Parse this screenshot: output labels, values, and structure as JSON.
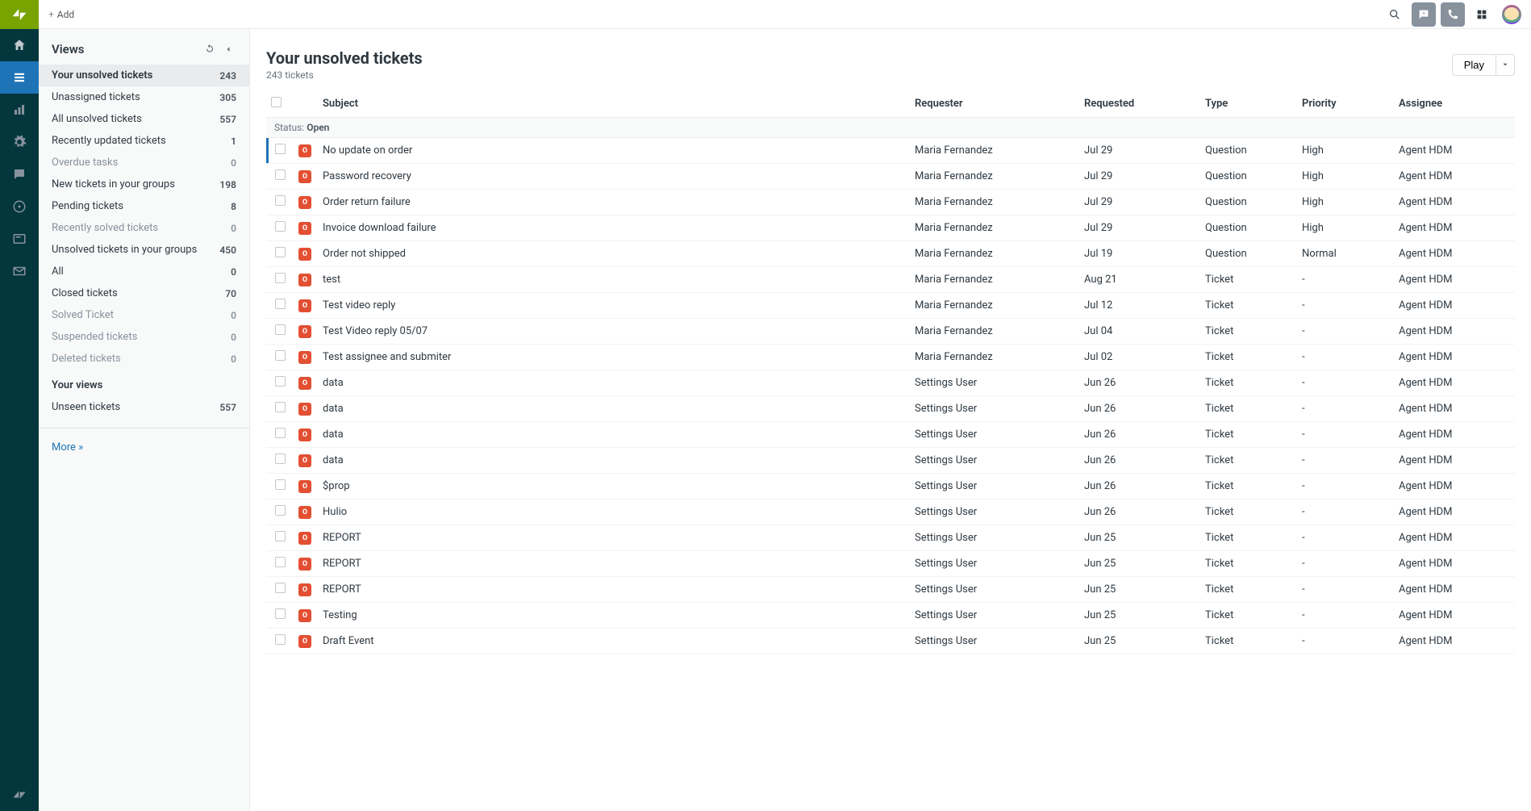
{
  "topbar": {
    "add_label": "Add"
  },
  "rail": {
    "items": [
      "home",
      "views",
      "reporting",
      "admin",
      "chat",
      "recent",
      "ssh",
      "mail"
    ]
  },
  "views_panel": {
    "title": "Views",
    "views": [
      {
        "label": "Your unsolved tickets",
        "count": "243",
        "selected": true,
        "muted": false
      },
      {
        "label": "Unassigned tickets",
        "count": "305",
        "selected": false,
        "muted": false
      },
      {
        "label": "All unsolved tickets",
        "count": "557",
        "selected": false,
        "muted": false
      },
      {
        "label": "Recently updated tickets",
        "count": "1",
        "selected": false,
        "muted": false
      },
      {
        "label": "Overdue tasks",
        "count": "0",
        "selected": false,
        "muted": true
      },
      {
        "label": "New tickets in your groups",
        "count": "198",
        "selected": false,
        "muted": false
      },
      {
        "label": "Pending tickets",
        "count": "8",
        "selected": false,
        "muted": false
      },
      {
        "label": "Recently solved tickets",
        "count": "0",
        "selected": false,
        "muted": true
      },
      {
        "label": "Unsolved tickets in your groups",
        "count": "450",
        "selected": false,
        "muted": false
      },
      {
        "label": "All",
        "count": "0",
        "selected": false,
        "muted": false
      },
      {
        "label": "Closed tickets",
        "count": "70",
        "selected": false,
        "muted": false
      },
      {
        "label": "Solved Ticket",
        "count": "0",
        "selected": false,
        "muted": true
      },
      {
        "label": "Suspended tickets",
        "count": "0",
        "selected": false,
        "muted": true
      },
      {
        "label": "Deleted tickets",
        "count": "0",
        "selected": false,
        "muted": true
      }
    ],
    "your_views_title": "Your views",
    "your_views": [
      {
        "label": "Unseen tickets",
        "count": "557",
        "selected": false,
        "muted": false
      }
    ],
    "more_label": "More »"
  },
  "tickets": {
    "title": "Your unsolved tickets",
    "subtitle": "243 tickets",
    "play_label": "Play",
    "columns": {
      "subject": "Subject",
      "requester": "Requester",
      "requested": "Requested",
      "type": "Type",
      "priority": "Priority",
      "assignee": "Assignee"
    },
    "status_group_label": "Status:",
    "status_group_value": "Open",
    "status_badge_text": "O",
    "rows": [
      {
        "subject": "No update on order",
        "requester": "Maria Fernandez",
        "requested": "Jul 29",
        "type": "Question",
        "priority": "High",
        "assignee": "Agent HDM",
        "hl": true
      },
      {
        "subject": "Password recovery",
        "requester": "Maria Fernandez",
        "requested": "Jul 29",
        "type": "Question",
        "priority": "High",
        "assignee": "Agent HDM"
      },
      {
        "subject": "Order return failure",
        "requester": "Maria Fernandez",
        "requested": "Jul 29",
        "type": "Question",
        "priority": "High",
        "assignee": "Agent HDM"
      },
      {
        "subject": "Invoice download failure",
        "requester": "Maria Fernandez",
        "requested": "Jul 29",
        "type": "Question",
        "priority": "High",
        "assignee": "Agent HDM"
      },
      {
        "subject": "Order not shipped",
        "requester": "Maria Fernandez",
        "requested": "Jul 19",
        "type": "Question",
        "priority": "Normal",
        "assignee": "Agent HDM"
      },
      {
        "subject": "test",
        "requester": "Maria Fernandez",
        "requested": "Aug 21",
        "type": "Ticket",
        "priority": "-",
        "assignee": "Agent HDM"
      },
      {
        "subject": "Test video reply",
        "requester": "Maria Fernandez",
        "requested": "Jul 12",
        "type": "Ticket",
        "priority": "-",
        "assignee": "Agent HDM"
      },
      {
        "subject": "Test Video reply 05/07",
        "requester": "Maria Fernandez",
        "requested": "Jul 04",
        "type": "Ticket",
        "priority": "-",
        "assignee": "Agent HDM"
      },
      {
        "subject": "Test assignee and submiter",
        "requester": "Maria Fernandez",
        "requested": "Jul 02",
        "type": "Ticket",
        "priority": "-",
        "assignee": "Agent HDM"
      },
      {
        "subject": "data",
        "requester": "Settings User",
        "requested": "Jun 26",
        "type": "Ticket",
        "priority": "-",
        "assignee": "Agent HDM"
      },
      {
        "subject": "data",
        "requester": "Settings User",
        "requested": "Jun 26",
        "type": "Ticket",
        "priority": "-",
        "assignee": "Agent HDM"
      },
      {
        "subject": "data",
        "requester": "Settings User",
        "requested": "Jun 26",
        "type": "Ticket",
        "priority": "-",
        "assignee": "Agent HDM"
      },
      {
        "subject": "data",
        "requester": "Settings User",
        "requested": "Jun 26",
        "type": "Ticket",
        "priority": "-",
        "assignee": "Agent HDM"
      },
      {
        "subject": "$prop",
        "requester": "Settings User",
        "requested": "Jun 26",
        "type": "Ticket",
        "priority": "-",
        "assignee": "Agent HDM"
      },
      {
        "subject": "Hulio",
        "requester": "Settings User",
        "requested": "Jun 26",
        "type": "Ticket",
        "priority": "-",
        "assignee": "Agent HDM"
      },
      {
        "subject": "REPORT",
        "requester": "Settings User",
        "requested": "Jun 25",
        "type": "Ticket",
        "priority": "-",
        "assignee": "Agent HDM"
      },
      {
        "subject": "REPORT",
        "requester": "Settings User",
        "requested": "Jun 25",
        "type": "Ticket",
        "priority": "-",
        "assignee": "Agent HDM"
      },
      {
        "subject": "REPORT",
        "requester": "Settings User",
        "requested": "Jun 25",
        "type": "Ticket",
        "priority": "-",
        "assignee": "Agent HDM"
      },
      {
        "subject": "Testing",
        "requester": "Settings User",
        "requested": "Jun 25",
        "type": "Ticket",
        "priority": "-",
        "assignee": "Agent HDM"
      },
      {
        "subject": "Draft Event",
        "requester": "Settings User",
        "requested": "Jun 25",
        "type": "Ticket",
        "priority": "-",
        "assignee": "Agent HDM"
      }
    ]
  }
}
